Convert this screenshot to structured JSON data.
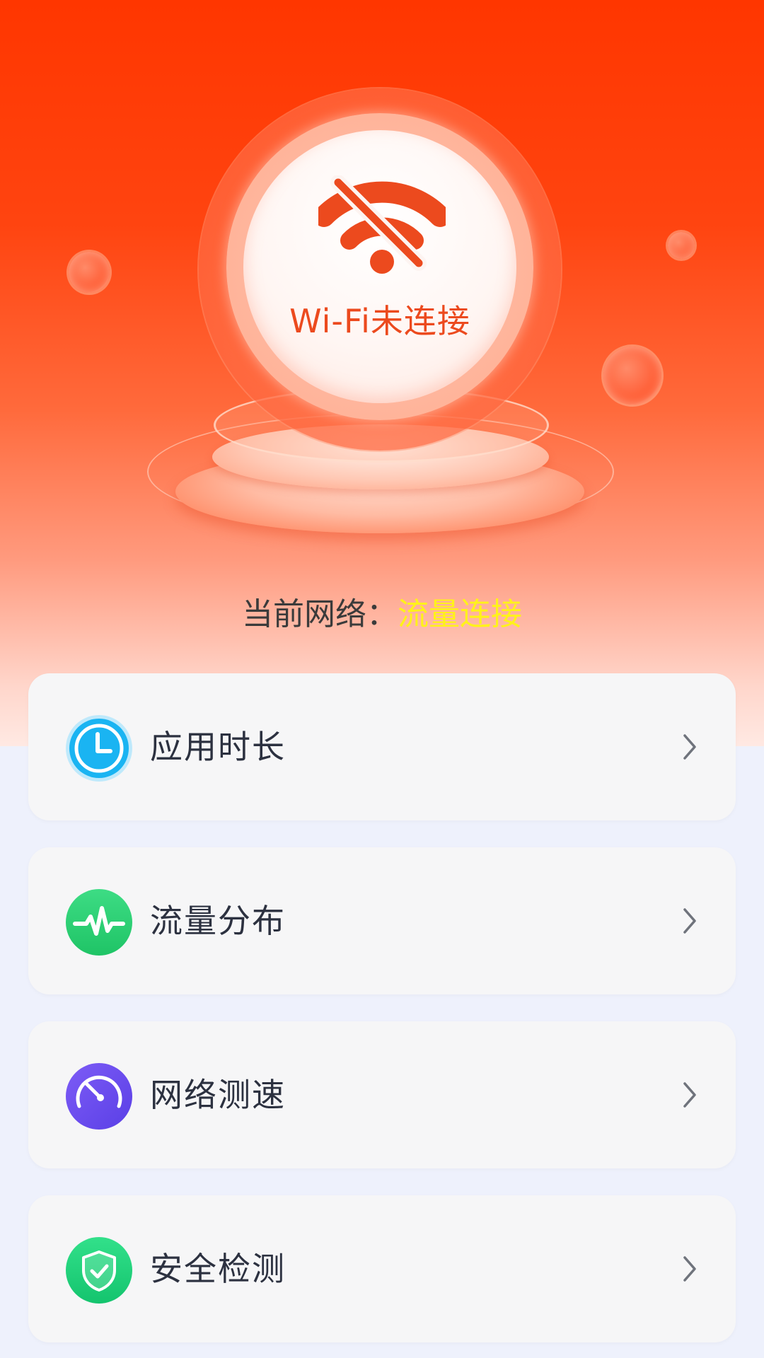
{
  "hero": {
    "wifi_status": "Wi-Fi未连接",
    "network_label": "当前网络：",
    "network_value": "流量连接"
  },
  "colors": {
    "hero_top": "#ff3600",
    "wifi_accent": "#ec4a1e",
    "network_value": "#fff21a",
    "page_background": "#eef1fc",
    "card_background": "#f6f6f7"
  },
  "menu": [
    {
      "label": "应用时长",
      "icon": "clock-icon",
      "icon_color": "#1ab4f2"
    },
    {
      "label": "流量分布",
      "icon": "pulse-icon",
      "icon_color": "#2bcf6c"
    },
    {
      "label": "网络测速",
      "icon": "speedometer-icon",
      "icon_color": "#6b4ef0"
    },
    {
      "label": "安全检测",
      "icon": "shield-check-icon",
      "icon_color": "#22d37c"
    }
  ]
}
